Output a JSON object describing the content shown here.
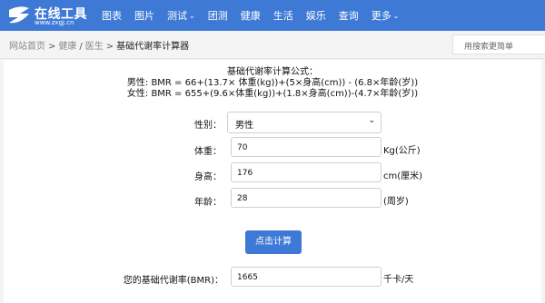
{
  "header": {
    "logo_text": "在线工具",
    "logo_sub": "www.zxgj.cn",
    "nav": [
      {
        "label": "图表"
      },
      {
        "label": "图片"
      },
      {
        "label": "测试",
        "dropdown": true
      },
      {
        "label": "团测"
      },
      {
        "label": "健康"
      },
      {
        "label": "生活"
      },
      {
        "label": "娱乐"
      },
      {
        "label": "查询"
      },
      {
        "label": "更多",
        "dropdown": true
      }
    ],
    "chevron": "⌄"
  },
  "breadcrumb": {
    "home": "网站首页",
    "health": "健康",
    "slash": "/",
    "doctor": "医生",
    "sep": ">",
    "current": "基础代谢率计算器"
  },
  "search": {
    "placeholder": "用搜索更简单"
  },
  "formula": {
    "title": "基础代谢率计算公式：",
    "male": "男性: BMR = 66+(13.7× 体重(kg))+(5×身高(cm)) - (6.8×年龄(岁))",
    "female": "女性: BMR = 655+(9.6×体重(kg))+(1.8×身高(cm))-(4.7×年龄(岁))"
  },
  "form": {
    "gender_label": "性别：",
    "gender_value": "男性",
    "weight_label": "体重：",
    "weight_value": "70",
    "weight_unit": "Kg(公斤)",
    "height_label": "身高：",
    "height_value": "176",
    "height_unit": "cm(厘米)",
    "age_label": "年龄：",
    "age_value": "28",
    "age_unit": "(周岁)",
    "submit_label": "点击计算",
    "result_label": "您的基础代谢率(BMR)：",
    "result_value": "1665",
    "result_unit": "千卡/天"
  },
  "colors": {
    "brand": "#3f79d6"
  }
}
